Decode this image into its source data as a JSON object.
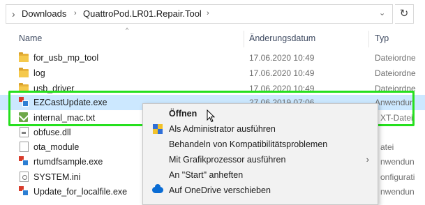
{
  "address_bar": {
    "breadcrumbs": [
      "Downloads",
      "QuattroPod.LR01.Repair.Tool"
    ],
    "refresh_icon": "refresh-icon"
  },
  "columns": {
    "name": "Name",
    "date": "Änderungsdatum",
    "type": "Typ",
    "sort_direction": "ascending"
  },
  "files": [
    {
      "name": "for_usb_mp_tool",
      "date": "17.06.2020 10:49",
      "type": "Dateiordne",
      "icon": "folder-icon"
    },
    {
      "name": "log",
      "date": "17.06.2020 10:49",
      "type": "Dateiordne",
      "icon": "folder-icon"
    },
    {
      "name": "usb_driver",
      "date": "17.06.2020 10:49",
      "type": "Dateiordne",
      "icon": "folder-icon"
    },
    {
      "name": "EZCastUpdate.exe",
      "date": "27.06.2019 07:06",
      "type": "Anwendun",
      "icon": "exe-icon",
      "selected": true
    },
    {
      "name": "internal_mac.txt",
      "date": "",
      "type": "XT-Datei",
      "icon": "text-file-icon"
    },
    {
      "name": "obfuse.dll",
      "date": "",
      "type": "",
      "icon": "dll-file-icon"
    },
    {
      "name": "ota_module",
      "date": "",
      "type": "atei",
      "icon": "file-icon"
    },
    {
      "name": "rtumdfsample.exe",
      "date": "",
      "type": "nwendun",
      "icon": "exe-icon"
    },
    {
      "name": "SYSTEM.ini",
      "date": "",
      "type": "onfigurati",
      "icon": "settings-file-icon"
    },
    {
      "name": "Update_for_localfile.exe",
      "date": "",
      "type": "nwendun",
      "icon": "exe-icon"
    }
  ],
  "context_menu": {
    "items": [
      {
        "label": "Öffnen",
        "bold": true,
        "icon": ""
      },
      {
        "label": "Als Administrator ausführen",
        "icon": "uac-shield-icon"
      },
      {
        "label": "Behandeln von Kompatibilitätsproblemen",
        "icon": ""
      },
      {
        "label": "Mit Grafikprozessor ausführen",
        "icon": "",
        "submenu": true
      },
      {
        "label": "An \"Start\" anheften",
        "icon": ""
      },
      {
        "label": "Auf OneDrive verschieben",
        "icon": "onedrive-icon"
      }
    ]
  },
  "colors": {
    "selection": "#cce8ff",
    "highlight_box": "#26e01e",
    "folder": "#f5c94c"
  }
}
